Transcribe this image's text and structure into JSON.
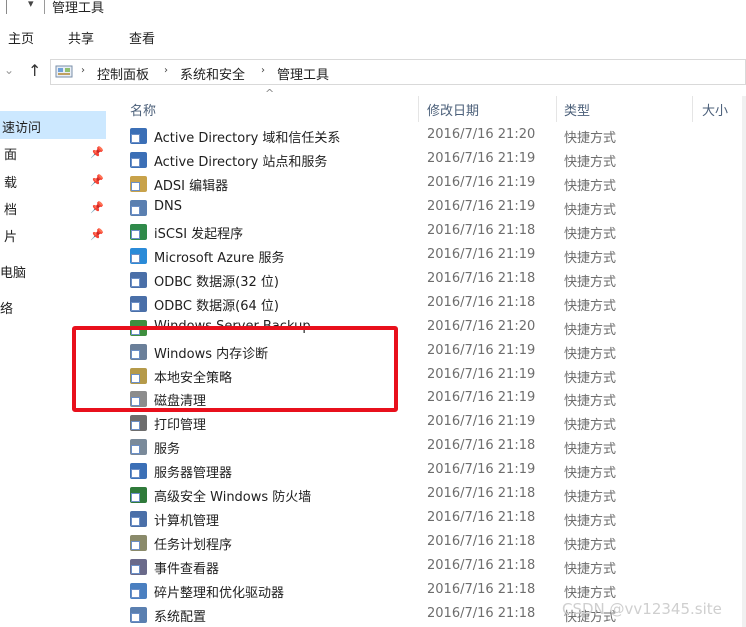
{
  "window": {
    "title": "管理工具"
  },
  "ribbon": {
    "tabs": [
      "主页",
      "共享",
      "查看"
    ]
  },
  "address": {
    "crumbs": [
      "控制面板",
      "系统和安全",
      "管理工具"
    ]
  },
  "nav": {
    "items": [
      {
        "label": "速访问",
        "pinned": false
      },
      {
        "label": "面",
        "pinned": true
      },
      {
        "label": "载",
        "pinned": true
      },
      {
        "label": "档",
        "pinned": true
      },
      {
        "label": "片",
        "pinned": true
      },
      {
        "label": "电脑",
        "pinned": false
      },
      {
        "label": "络",
        "pinned": false
      }
    ]
  },
  "columns": {
    "name": "名称",
    "date": "修改日期",
    "type": "类型",
    "size": "大小"
  },
  "files": [
    {
      "name": "Active Directory 域和信任关系",
      "date": "2016/7/16 21:20",
      "type": "快捷方式",
      "icon": "ad-domains-icon",
      "color": "#3b6fb6"
    },
    {
      "name": "Active Directory 站点和服务",
      "date": "2016/7/16 21:19",
      "type": "快捷方式",
      "icon": "ad-sites-icon",
      "color": "#3b6fb6"
    },
    {
      "name": "ADSI 编辑器",
      "date": "2016/7/16 21:19",
      "type": "快捷方式",
      "icon": "adsi-edit-icon",
      "color": "#c8a24a"
    },
    {
      "name": "DNS",
      "date": "2016/7/16 21:19",
      "type": "快捷方式",
      "icon": "dns-icon",
      "color": "#5a7fb0"
    },
    {
      "name": "iSCSI 发起程序",
      "date": "2016/7/16 21:18",
      "type": "快捷方式",
      "icon": "iscsi-icon",
      "color": "#2f8a4a"
    },
    {
      "name": "Microsoft Azure 服务",
      "date": "2016/7/16 21:19",
      "type": "快捷方式",
      "icon": "azure-icon",
      "color": "#2a8bd8"
    },
    {
      "name": "ODBC 数据源(32 位)",
      "date": "2016/7/16 21:18",
      "type": "快捷方式",
      "icon": "odbc-icon",
      "color": "#4a6fa8"
    },
    {
      "name": "ODBC 数据源(64 位)",
      "date": "2016/7/16 21:18",
      "type": "快捷方式",
      "icon": "odbc-icon",
      "color": "#4a6fa8"
    },
    {
      "name": "Windows Server Backup",
      "date": "2016/7/16 21:20",
      "type": "快捷方式",
      "icon": "backup-icon",
      "color": "#3f8f3f"
    },
    {
      "name": "Windows 内存诊断",
      "date": "2016/7/16 21:19",
      "type": "快捷方式",
      "icon": "memory-diagnostic-icon",
      "color": "#6a7f99"
    },
    {
      "name": "本地安全策略",
      "date": "2016/7/16 21:19",
      "type": "快捷方式",
      "icon": "security-policy-icon",
      "color": "#b59a4a"
    },
    {
      "name": "磁盘清理",
      "date": "2016/7/16 21:19",
      "type": "快捷方式",
      "icon": "disk-cleanup-icon",
      "color": "#8c8c8c"
    },
    {
      "name": "打印管理",
      "date": "2016/7/16 21:19",
      "type": "快捷方式",
      "icon": "print-management-icon",
      "color": "#6d6d6d"
    },
    {
      "name": "服务",
      "date": "2016/7/16 21:18",
      "type": "快捷方式",
      "icon": "services-icon",
      "color": "#7a8a9a"
    },
    {
      "name": "服务器管理器",
      "date": "2016/7/16 21:19",
      "type": "快捷方式",
      "icon": "server-manager-icon",
      "color": "#3b6fb6"
    },
    {
      "name": "高级安全 Windows 防火墙",
      "date": "2016/7/16 21:18",
      "type": "快捷方式",
      "icon": "firewall-icon",
      "color": "#2f7a3a"
    },
    {
      "name": "计算机管理",
      "date": "2016/7/16 21:18",
      "type": "快捷方式",
      "icon": "computer-management-icon",
      "color": "#4a6fa8"
    },
    {
      "name": "任务计划程序",
      "date": "2016/7/16 21:18",
      "type": "快捷方式",
      "icon": "task-scheduler-icon",
      "color": "#8a8a6a"
    },
    {
      "name": "事件查看器",
      "date": "2016/7/16 21:18",
      "type": "快捷方式",
      "icon": "event-viewer-icon",
      "color": "#6a6a8a"
    },
    {
      "name": "碎片整理和优化驱动器",
      "date": "2016/7/16 21:18",
      "type": "快捷方式",
      "icon": "defrag-icon",
      "color": "#4a7fc0"
    },
    {
      "name": "系统配置",
      "date": "2016/7/16 21:18",
      "type": "快捷方式",
      "icon": "system-config-icon",
      "color": "#5a7fb0"
    }
  ],
  "watermark": "CSDN @vv12345.site",
  "colors": {
    "selection": "#cce8ff",
    "highlight_border": "#e8101c"
  }
}
